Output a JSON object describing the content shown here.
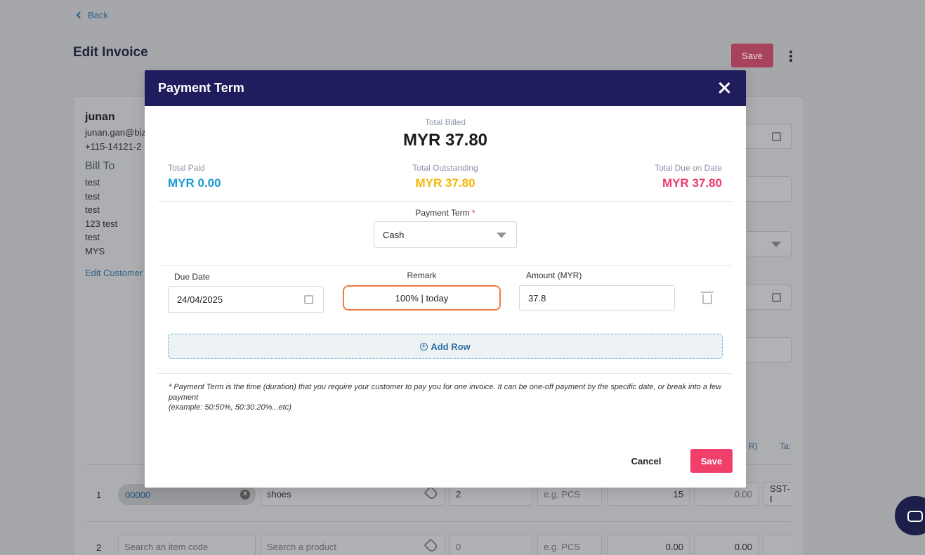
{
  "background": {
    "back_label": "Back",
    "page_title": "Edit Invoice",
    "save_label": "Save",
    "customer": {
      "name": "junan",
      "email": "junan.gan@biz",
      "phone": "+115-14121-2",
      "bill_to_label": "Bill To",
      "address_lines": [
        "test",
        "test",
        "test",
        "123 test",
        "test",
        "MYS"
      ],
      "edit_link": "Edit Customer"
    },
    "column_fragments": {
      "r": "R)",
      "ta": "Ta:"
    },
    "rows": [
      {
        "no": "1",
        "item_code": "00000",
        "product": "shoes",
        "qty": "2",
        "uom_placeholder": "e.g. PCS",
        "price": "15",
        "discount": "0.00",
        "tax": "SST-I"
      },
      {
        "no": "2",
        "item_code_placeholder": "Search an item code",
        "product_placeholder": "Search a product",
        "qty": "0",
        "uom_placeholder": "e.g. PCS",
        "price": "0.00",
        "discount": "0.00"
      }
    ]
  },
  "modal": {
    "title": "Payment Term",
    "total_billed_label": "Total Billed",
    "total_billed_value": "MYR 37.80",
    "total_paid_label": "Total Paid",
    "total_paid_value": "MYR 0.00",
    "total_outstanding_label": "Total Outstanding",
    "total_outstanding_value": "MYR 37.80",
    "total_due_label": "Total Due on Date",
    "total_due_value": "MYR 37.80",
    "payment_term_label": "Payment Term",
    "payment_term_required": "*",
    "payment_term_value": "Cash",
    "due_date_label": "Due Date",
    "due_date_value": "24/04/2025",
    "remark_label": "Remark",
    "remark_value": "100% |  today",
    "amount_label": "Amount (MYR)",
    "amount_value": "37.8",
    "add_row_label": "Add Row",
    "note_line1": "* Payment Term is the time (duration) that you require your customer to pay you for one invoice. It can be one-off payment by the specific date, or break into a few payment",
    "note_line2": "(example: 50:50%, 50:30:20%...etc)",
    "cancel_label": "Cancel",
    "save_label": "Save"
  },
  "colors": {
    "header_bg": "#1f1d5e",
    "paid": "#1b9ad6",
    "outstanding": "#f2b705",
    "due": "#ec3a6a",
    "save_button": "#ef3f6a",
    "remark_highlight": "#f07b3f"
  },
  "icons": [
    "chevron-left-icon",
    "kebab-menu-icon",
    "close-icon",
    "dropdown-caret-icon",
    "calendar-icon",
    "trash-icon",
    "plus-circle-icon",
    "tag-icon",
    "clear-icon",
    "chat-icon"
  ]
}
